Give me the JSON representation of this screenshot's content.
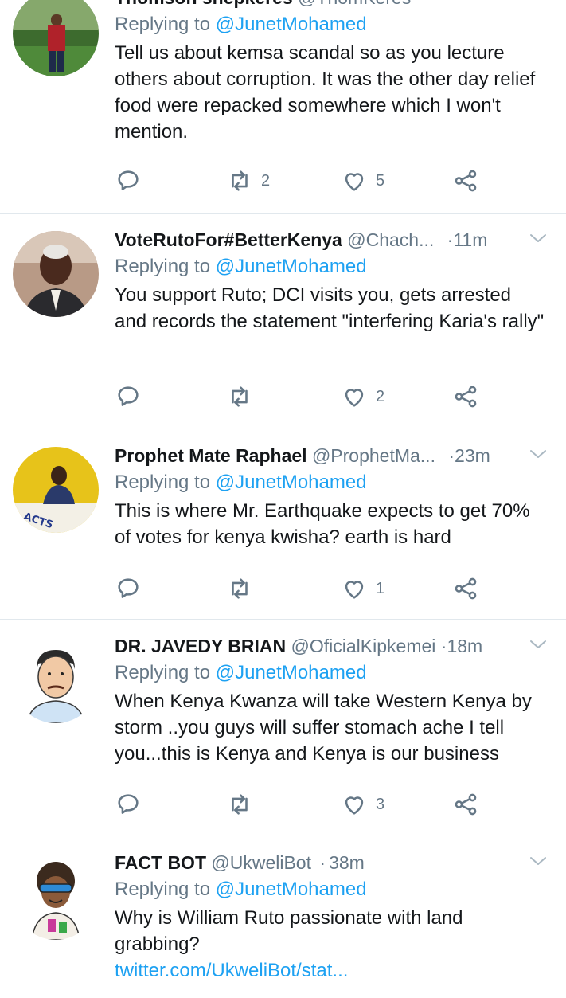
{
  "tweets": [
    {
      "name": "Thomson shepkeres",
      "handle": "@ThomKeres",
      "time": "",
      "replying_prefix": "Replying to ",
      "replying_to": "@JunetMohamed",
      "text": "Tell us about kemsa scandal so as you lecture others about corruption. It was the other day relief food were repacked somewhere which I won't mention.",
      "link": "",
      "replies": "",
      "retweets": "2",
      "likes": "5"
    },
    {
      "name": "VoteRutoFor#BetterKenya",
      "handle": "@Chach...",
      "time": "11m",
      "replying_prefix": "Replying to ",
      "replying_to": "@JunetMohamed",
      "text": "You support Ruto; DCI visits you, gets arrested and records the statement \"interfering Karia's rally\"",
      "link": "",
      "replies": "",
      "retweets": "",
      "likes": "2"
    },
    {
      "name": "Prophet Mate Raphael",
      "handle": "@ProphetMa...",
      "time": "23m",
      "replying_prefix": "Replying to ",
      "replying_to": "@JunetMohamed",
      "text": "This is where Mr. Earthquake expects to get 70% of votes for kenya kwisha? earth is hard",
      "link": "",
      "replies": "",
      "retweets": "",
      "likes": "1"
    },
    {
      "name": "DR. JAVEDY BRIAN",
      "handle": "@OficialKipkemei",
      "time": "18m",
      "replying_prefix": "Replying to ",
      "replying_to": "@JunetMohamed",
      "text": "When Kenya Kwanza will take Western Kenya by storm ..you guys will suffer stomach ache I tell you...this is Kenya and Kenya is our business",
      "link": "",
      "replies": "",
      "retweets": "",
      "likes": "3"
    },
    {
      "name": "FACT BOT",
      "handle": "@UkweliBot",
      "time": "38m",
      "replying_prefix": "Replying to ",
      "replying_to": "@JunetMohamed",
      "text": "Why is William Ruto passionate with land grabbing?",
      "link": "twitter.com/UkweliBot/stat...",
      "replies": "",
      "retweets": "",
      "likes": ""
    }
  ],
  "separator": "·",
  "icons": {
    "reply": "reply-icon",
    "retweet": "retweet-icon",
    "like": "heart-icon",
    "share": "share-icon",
    "more": "chevron-down-icon"
  },
  "colors": {
    "text": "#14171a",
    "muted": "#657786",
    "accent": "#1da1f2",
    "divider": "#e1e8ed"
  }
}
